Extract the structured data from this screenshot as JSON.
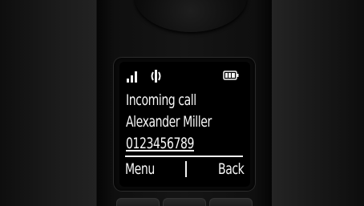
{
  "status_bar": {
    "signal_icon": "signal-strength-icon",
    "ringer_icon": "ringer-icon",
    "battery_icon": "battery-full-icon"
  },
  "call": {
    "title": "Incoming call",
    "caller_name": "Alexander Miller",
    "caller_number": "0123456789"
  },
  "softkeys": {
    "left_label": "Menu",
    "right_label": "Back"
  },
  "colors": {
    "display_background": "#000000",
    "display_text": "#f7f7f7",
    "handset_body": "#151515"
  }
}
